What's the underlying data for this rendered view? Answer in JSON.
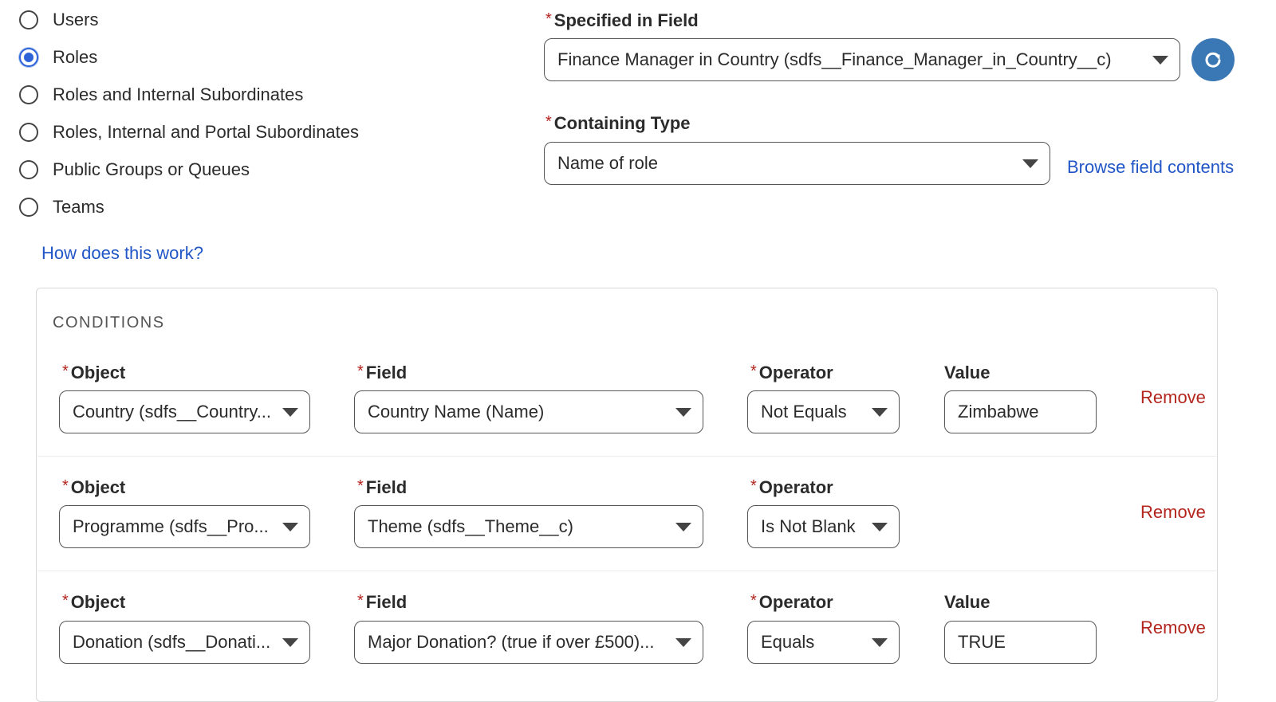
{
  "share_with": {
    "options": [
      {
        "label": "Users",
        "checked": false
      },
      {
        "label": "Roles",
        "checked": true
      },
      {
        "label": "Roles and Internal Subordinates",
        "checked": false
      },
      {
        "label": "Roles, Internal and Portal Subordinates",
        "checked": false
      },
      {
        "label": "Public Groups or Queues",
        "checked": false
      },
      {
        "label": "Teams",
        "checked": false
      }
    ],
    "help_link": "How does this work?"
  },
  "specified_in_field": {
    "required": "*",
    "label": "Specified in Field",
    "value": "Finance Manager in Country (sdfs__Finance_Manager_in_Country__c)",
    "refresh_icon": "refresh-icon"
  },
  "containing_type": {
    "required": "*",
    "label": "Containing Type",
    "value": "Name of role",
    "browse_link": "Browse field contents"
  },
  "conditions": {
    "title": "CONDITIONS",
    "rows": [
      {
        "object_label": "Object",
        "object_value": "Country (sdfs__Country...",
        "field_label": "Field",
        "field_value": "Country Name (Name)",
        "operator_label": "Operator",
        "operator_value": "Not Equals",
        "value_label": "Value",
        "value": "Zimbabwe",
        "remove_label": "Remove"
      },
      {
        "object_label": "Object",
        "object_value": "Programme (sdfs__Pro...",
        "field_label": "Field",
        "field_value": "Theme (sdfs__Theme__c)",
        "operator_label": "Operator",
        "operator_value": "Is Not Blank",
        "remove_label": "Remove"
      },
      {
        "object_label": "Object",
        "object_value": "Donation (sdfs__Donati...",
        "field_label": "Field",
        "field_value": "Major Donation? (true if over £500)...",
        "operator_label": "Operator",
        "operator_value": "Equals",
        "value_label": "Value",
        "value": "TRUE",
        "remove_label": "Remove"
      }
    ]
  },
  "colors": {
    "accent": "#2e63d8",
    "link": "#2156c7",
    "remove": "#b3261e",
    "button": "#3a78b5"
  }
}
